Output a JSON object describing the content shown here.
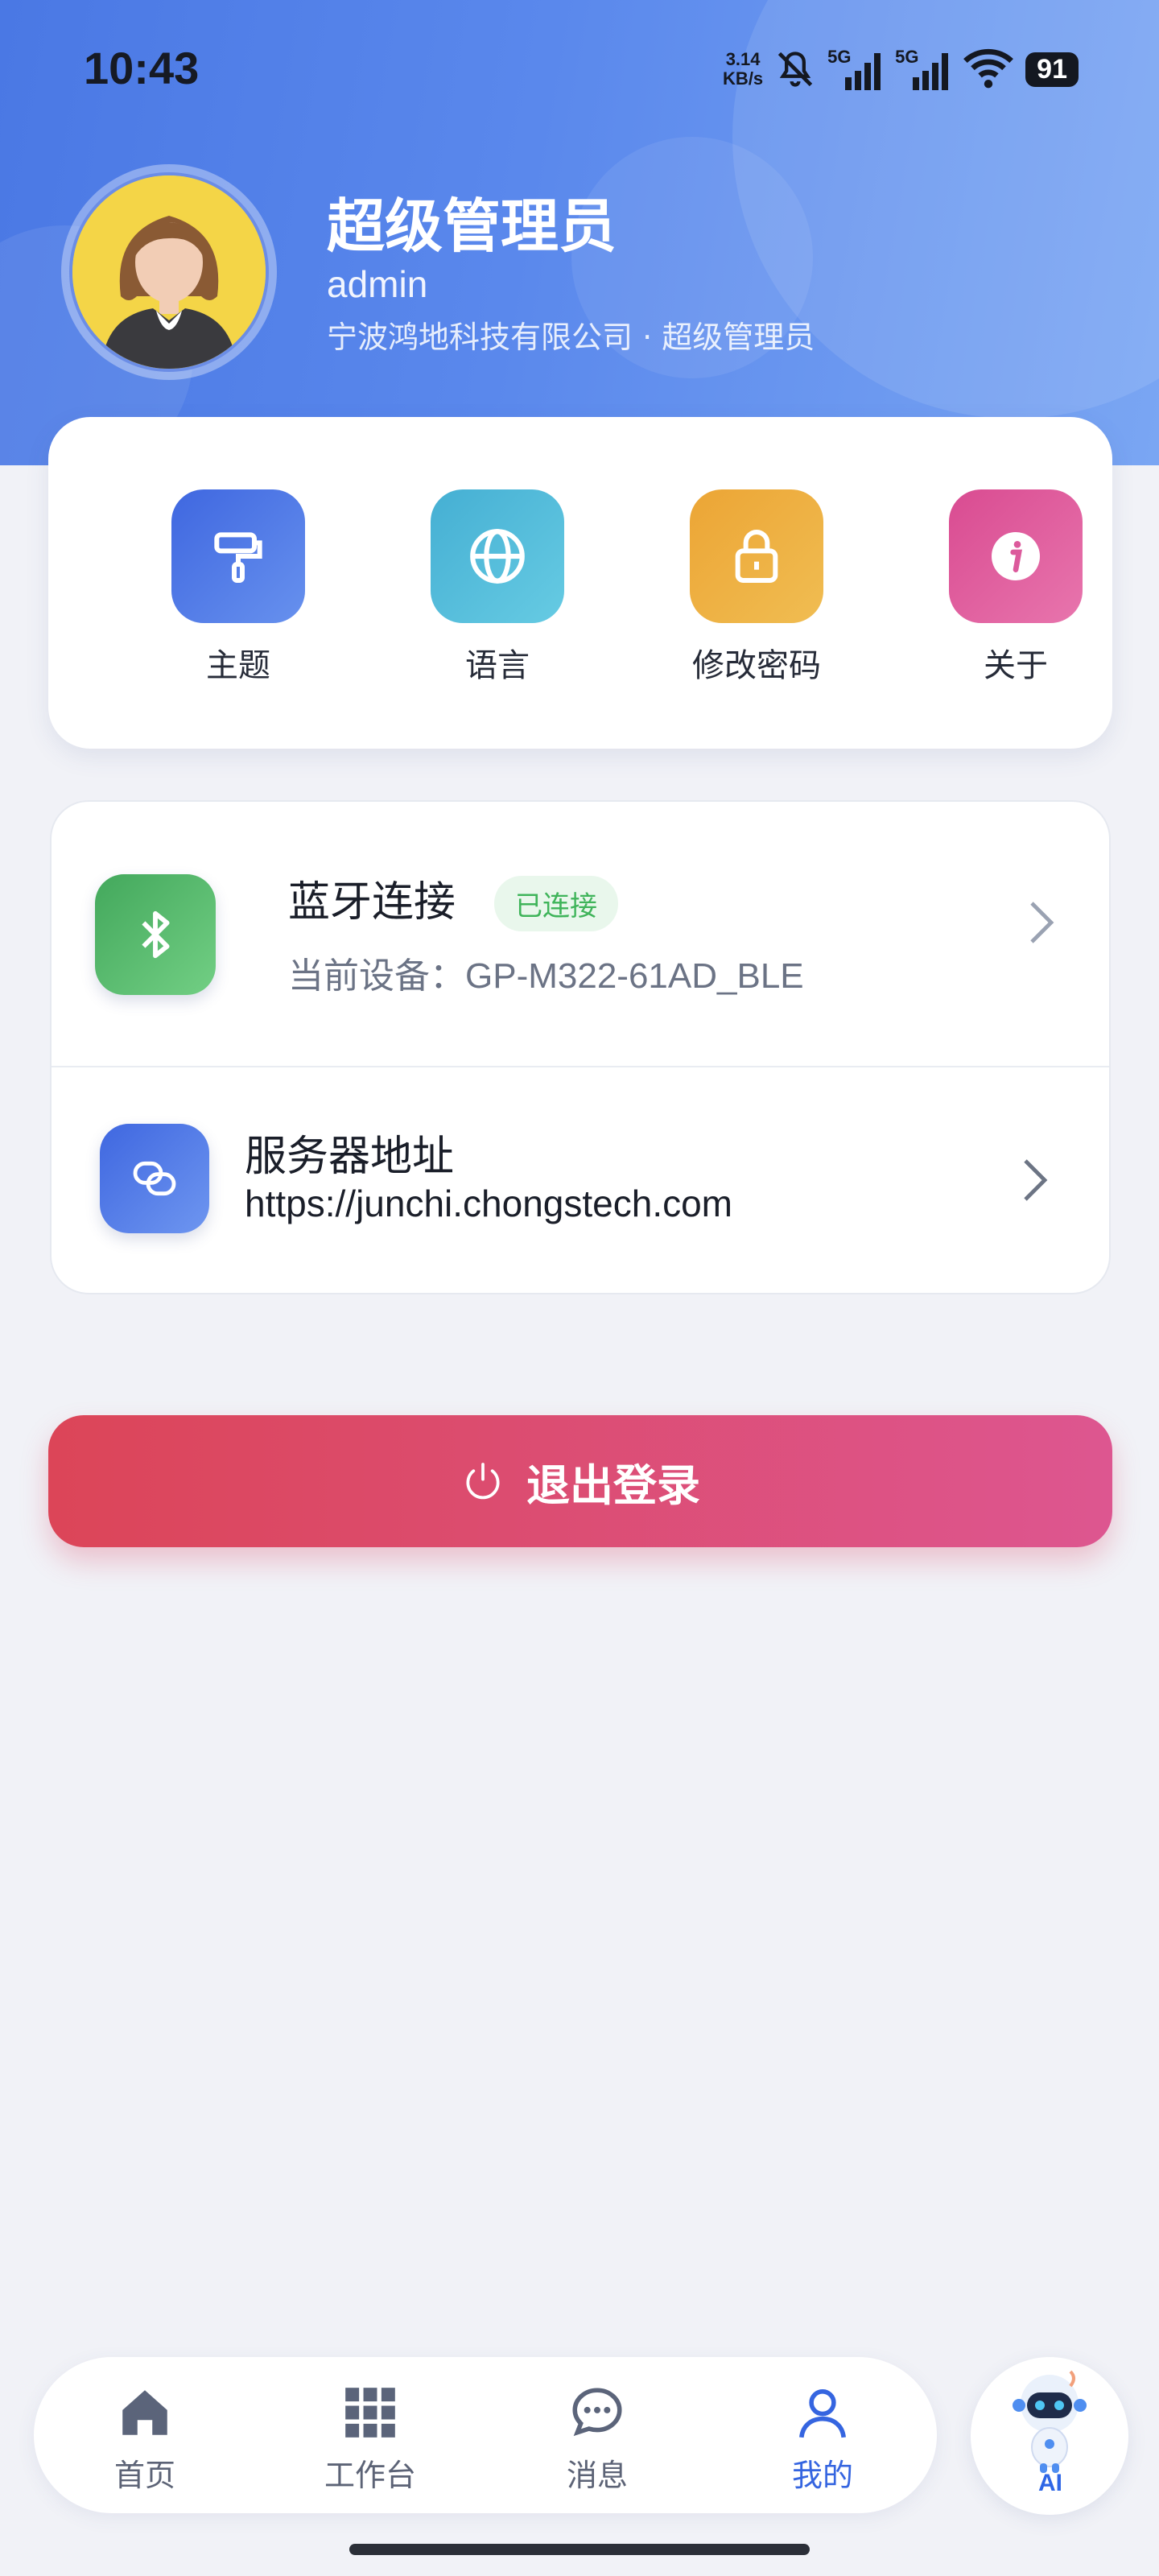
{
  "status_bar": {
    "time": "10:43",
    "net_speed_value": "3.14",
    "net_speed_unit": "KB/s",
    "signal_1_label": "5G",
    "signal_2_label": "5G",
    "battery": "91"
  },
  "profile": {
    "display_name": "超级管理员",
    "username": "admin",
    "organization": "宁波鸿地科技有限公司 · 超级管理员"
  },
  "quick_actions": [
    {
      "label": "主题",
      "icon": "paint-roller-icon",
      "color": "#4a74e6"
    },
    {
      "label": "语言",
      "icon": "globe-icon",
      "color": "#4fbad6"
    },
    {
      "label": "修改密码",
      "icon": "lock-icon",
      "color": "#eeae3a"
    },
    {
      "label": "关于",
      "icon": "info-icon",
      "color": "#e05c9c"
    }
  ],
  "settings": {
    "bluetooth": {
      "title": "蓝牙连接",
      "badge": "已连接",
      "subtitle": "当前设备：GP-M322-61AD_BLE",
      "icon": "bluetooth-icon",
      "color": "#4cb86a"
    },
    "server": {
      "title": "服务器地址",
      "url": "https://junchi.chongstech.com",
      "icon": "link-icon",
      "color": "#4a74e6"
    }
  },
  "logout": {
    "label": "退出登录",
    "icon": "power-icon"
  },
  "bottom_nav": {
    "items": [
      {
        "label": "首页",
        "icon": "home-icon"
      },
      {
        "label": "工作台",
        "icon": "grid-icon"
      },
      {
        "label": "消息",
        "icon": "chat-icon"
      },
      {
        "label": "我的",
        "icon": "user-icon",
        "active": true
      }
    ],
    "active_color": "#3565e0",
    "ai_label": "AI"
  }
}
